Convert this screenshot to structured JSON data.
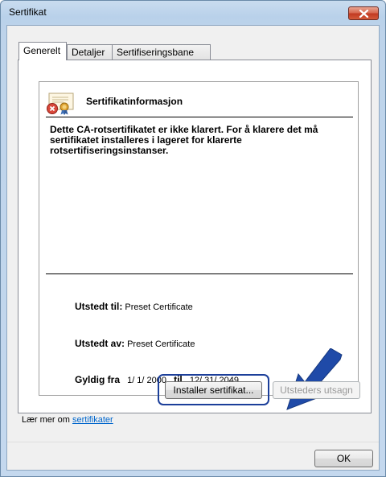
{
  "window": {
    "title": "Sertifikat"
  },
  "tabs": [
    {
      "label": "Generelt",
      "active": true
    },
    {
      "label": "Detaljer",
      "active": false
    },
    {
      "label": "Sertifiseringsbane",
      "active": false
    }
  ],
  "cert": {
    "header": "Sertifikatinformasjon",
    "description": "Dette CA-rotsertifikatet er ikke klarert. For å klarere det må sertifikatet installeres i lageret for klarerte rotsertifiseringsinstanser.",
    "issued_to_label": "Utstedt til:",
    "issued_to_value": "Preset Certificate",
    "issued_by_label": "Utstedt av:",
    "issued_by_value": "Preset Certificate",
    "valid_from_label": "Gyldig fra",
    "valid_from_value": "1/ 1/ 2000",
    "valid_to_label": "til",
    "valid_to_value": "12/ 31/ 2049"
  },
  "buttons": {
    "install": "Installer sertifikat...",
    "issuer_statement": "Utsteders utsagn",
    "ok": "OK"
  },
  "learn_more": {
    "prefix": "Lær mer om ",
    "link": "sertifikater"
  },
  "colors": {
    "highlight": "#1c3f9a",
    "arrow": "#1f4aa8",
    "close_button": "#c7452c"
  }
}
